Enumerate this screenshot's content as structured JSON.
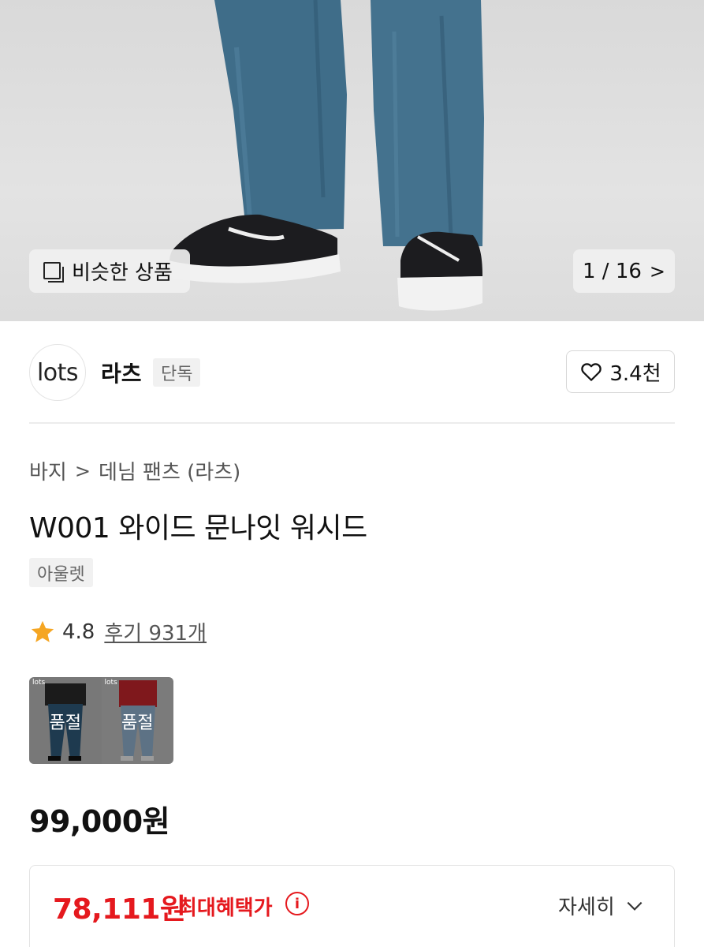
{
  "hero": {
    "similar_label": "비슷한 상품",
    "pager_text": "1 / 16",
    "pager_chevron": ">"
  },
  "brand": {
    "logo_text": "lots",
    "name": "라츠",
    "tag": "단독",
    "like_count": "3.4천"
  },
  "breadcrumb": {
    "category": "바지",
    "separator": ">",
    "subcategory": "데님 팬츠 (라츠)"
  },
  "product": {
    "title": "W001 와이드 문나잇 워시드",
    "outlet_tag": "아울렛",
    "rating": "4.8",
    "reviews": "후기 931개",
    "options": [
      {
        "logo": "lots",
        "label": "품절"
      },
      {
        "logo": "lots",
        "label": "품절"
      }
    ],
    "price": "99,000원"
  },
  "benefit": {
    "price": "78,111원",
    "label": "최대혜택가",
    "info_icon": "i",
    "detail": "자세히"
  },
  "colors": {
    "accent_red": "#e5191e",
    "star": "#f5a623"
  }
}
